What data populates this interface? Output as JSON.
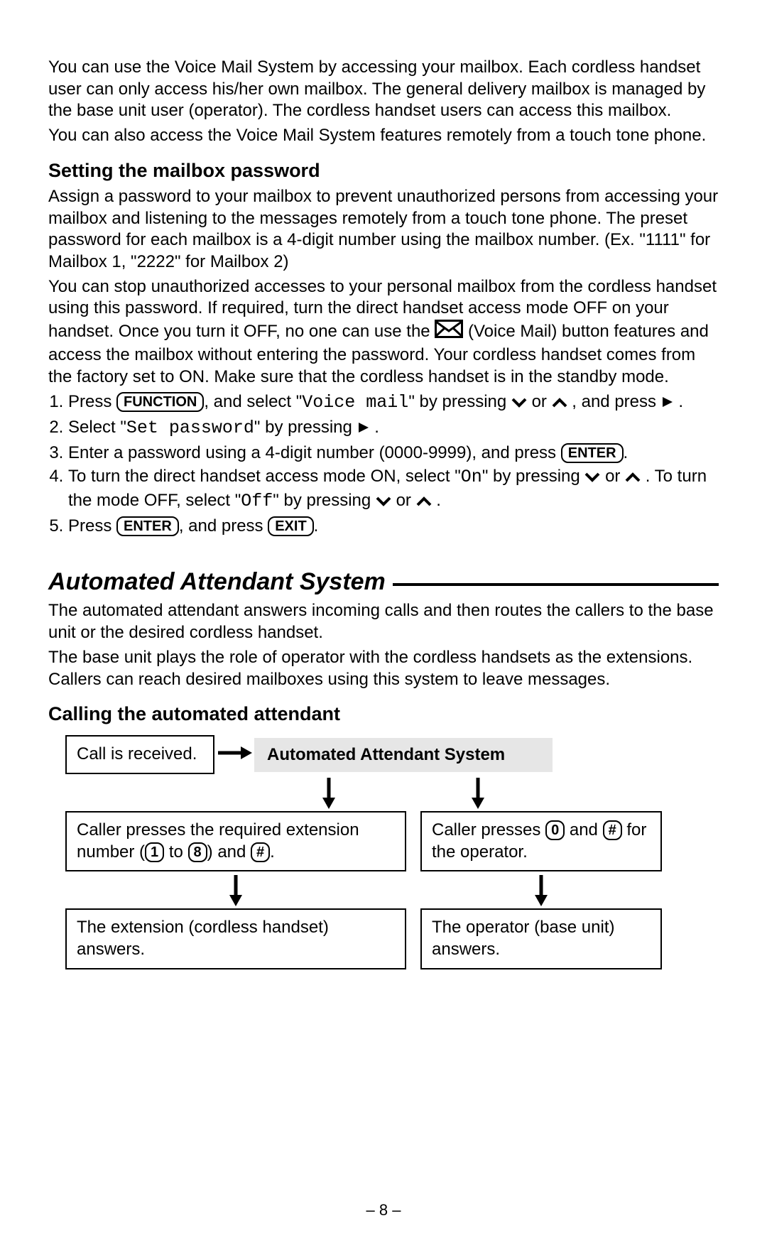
{
  "intro": {
    "p1": "You can use the Voice Mail System by accessing your mailbox. Each cordless handset user can only access his/her own mailbox. The general delivery mailbox is managed by the base unit user (operator). The cordless handset users can access this mailbox.",
    "p2": "You can also access the Voice Mail System features remotely from a touch tone phone."
  },
  "section1": {
    "heading": "Setting the mailbox password",
    "p1": "Assign a password to your mailbox to prevent unauthorized persons from accessing your mailbox and listening to the messages remotely from a touch tone phone. The preset password for each mailbox is a 4-digit number using the mailbox number. (Ex. \"1111\" for Mailbox 1, \"2222\" for Mailbox 2)",
    "p2a": "You can stop unauthorized accesses to your personal mailbox from the cordless handset using this password. If required, turn the direct handset access mode OFF on your handset. Once you turn it OFF, no one can use the ",
    "p2b": " (Voice Mail) button features and access the mailbox without entering the password. Your cordless handset comes from the factory set to ON. Make sure that the cordless handset is in the standby mode.",
    "steps": {
      "s1a": "Press ",
      "s1_key1": "FUNCTION",
      "s1b": ", and select \"",
      "s1_mono": "Voice mail",
      "s1c": "\" by pressing ",
      "s1d": " or ",
      "s1e": " , and press ",
      "s1f": " .",
      "s2a": "Select \"",
      "s2_mono": "Set password",
      "s2b": "\" by pressing ",
      "s2c": " .",
      "s3a": "Enter a password using a 4-digit number (0000-9999), and press ",
      "s3_key": "ENTER",
      "s3b": ".",
      "s4a": "To turn the direct handset access mode ON, select \"",
      "s4_mono1": "On",
      "s4b": "\" by pressing ",
      "s4c": " or ",
      "s4d": " . To turn the mode OFF, select \"",
      "s4_mono2": "Off",
      "s4e": "\" by pressing ",
      "s4f": " or ",
      "s4g": " .",
      "s5a": "Press ",
      "s5_key1": "ENTER",
      "s5b": ", and press ",
      "s5_key2": "EXIT",
      "s5c": "."
    }
  },
  "section2": {
    "heading": "Automated Attendant System",
    "p1": "The automated attendant answers incoming calls and then routes the callers to the base unit or the desired cordless handset.",
    "p2": "The base unit plays the role of operator with the cordless handsets as the extensions. Callers can reach desired mailboxes using this system to leave messages.",
    "sub": "Calling the automated attendant",
    "diagram": {
      "box_call": "Call is received.",
      "box_system": "Automated Attendant System",
      "left_mid_a": "Caller presses the required extension number (",
      "left_mid_b": " to ",
      "left_mid_c": ") and ",
      "left_mid_d": ".",
      "right_mid_a": "Caller presses ",
      "right_mid_b": " and ",
      "right_mid_c": " for the operator.",
      "left_bot": "The extension (cordless handset) answers.",
      "right_bot": "The operator (base unit) answers.",
      "key1": "1",
      "key8": "8",
      "keyhash": "#",
      "key0": "0"
    }
  },
  "footer": "– 8 –"
}
